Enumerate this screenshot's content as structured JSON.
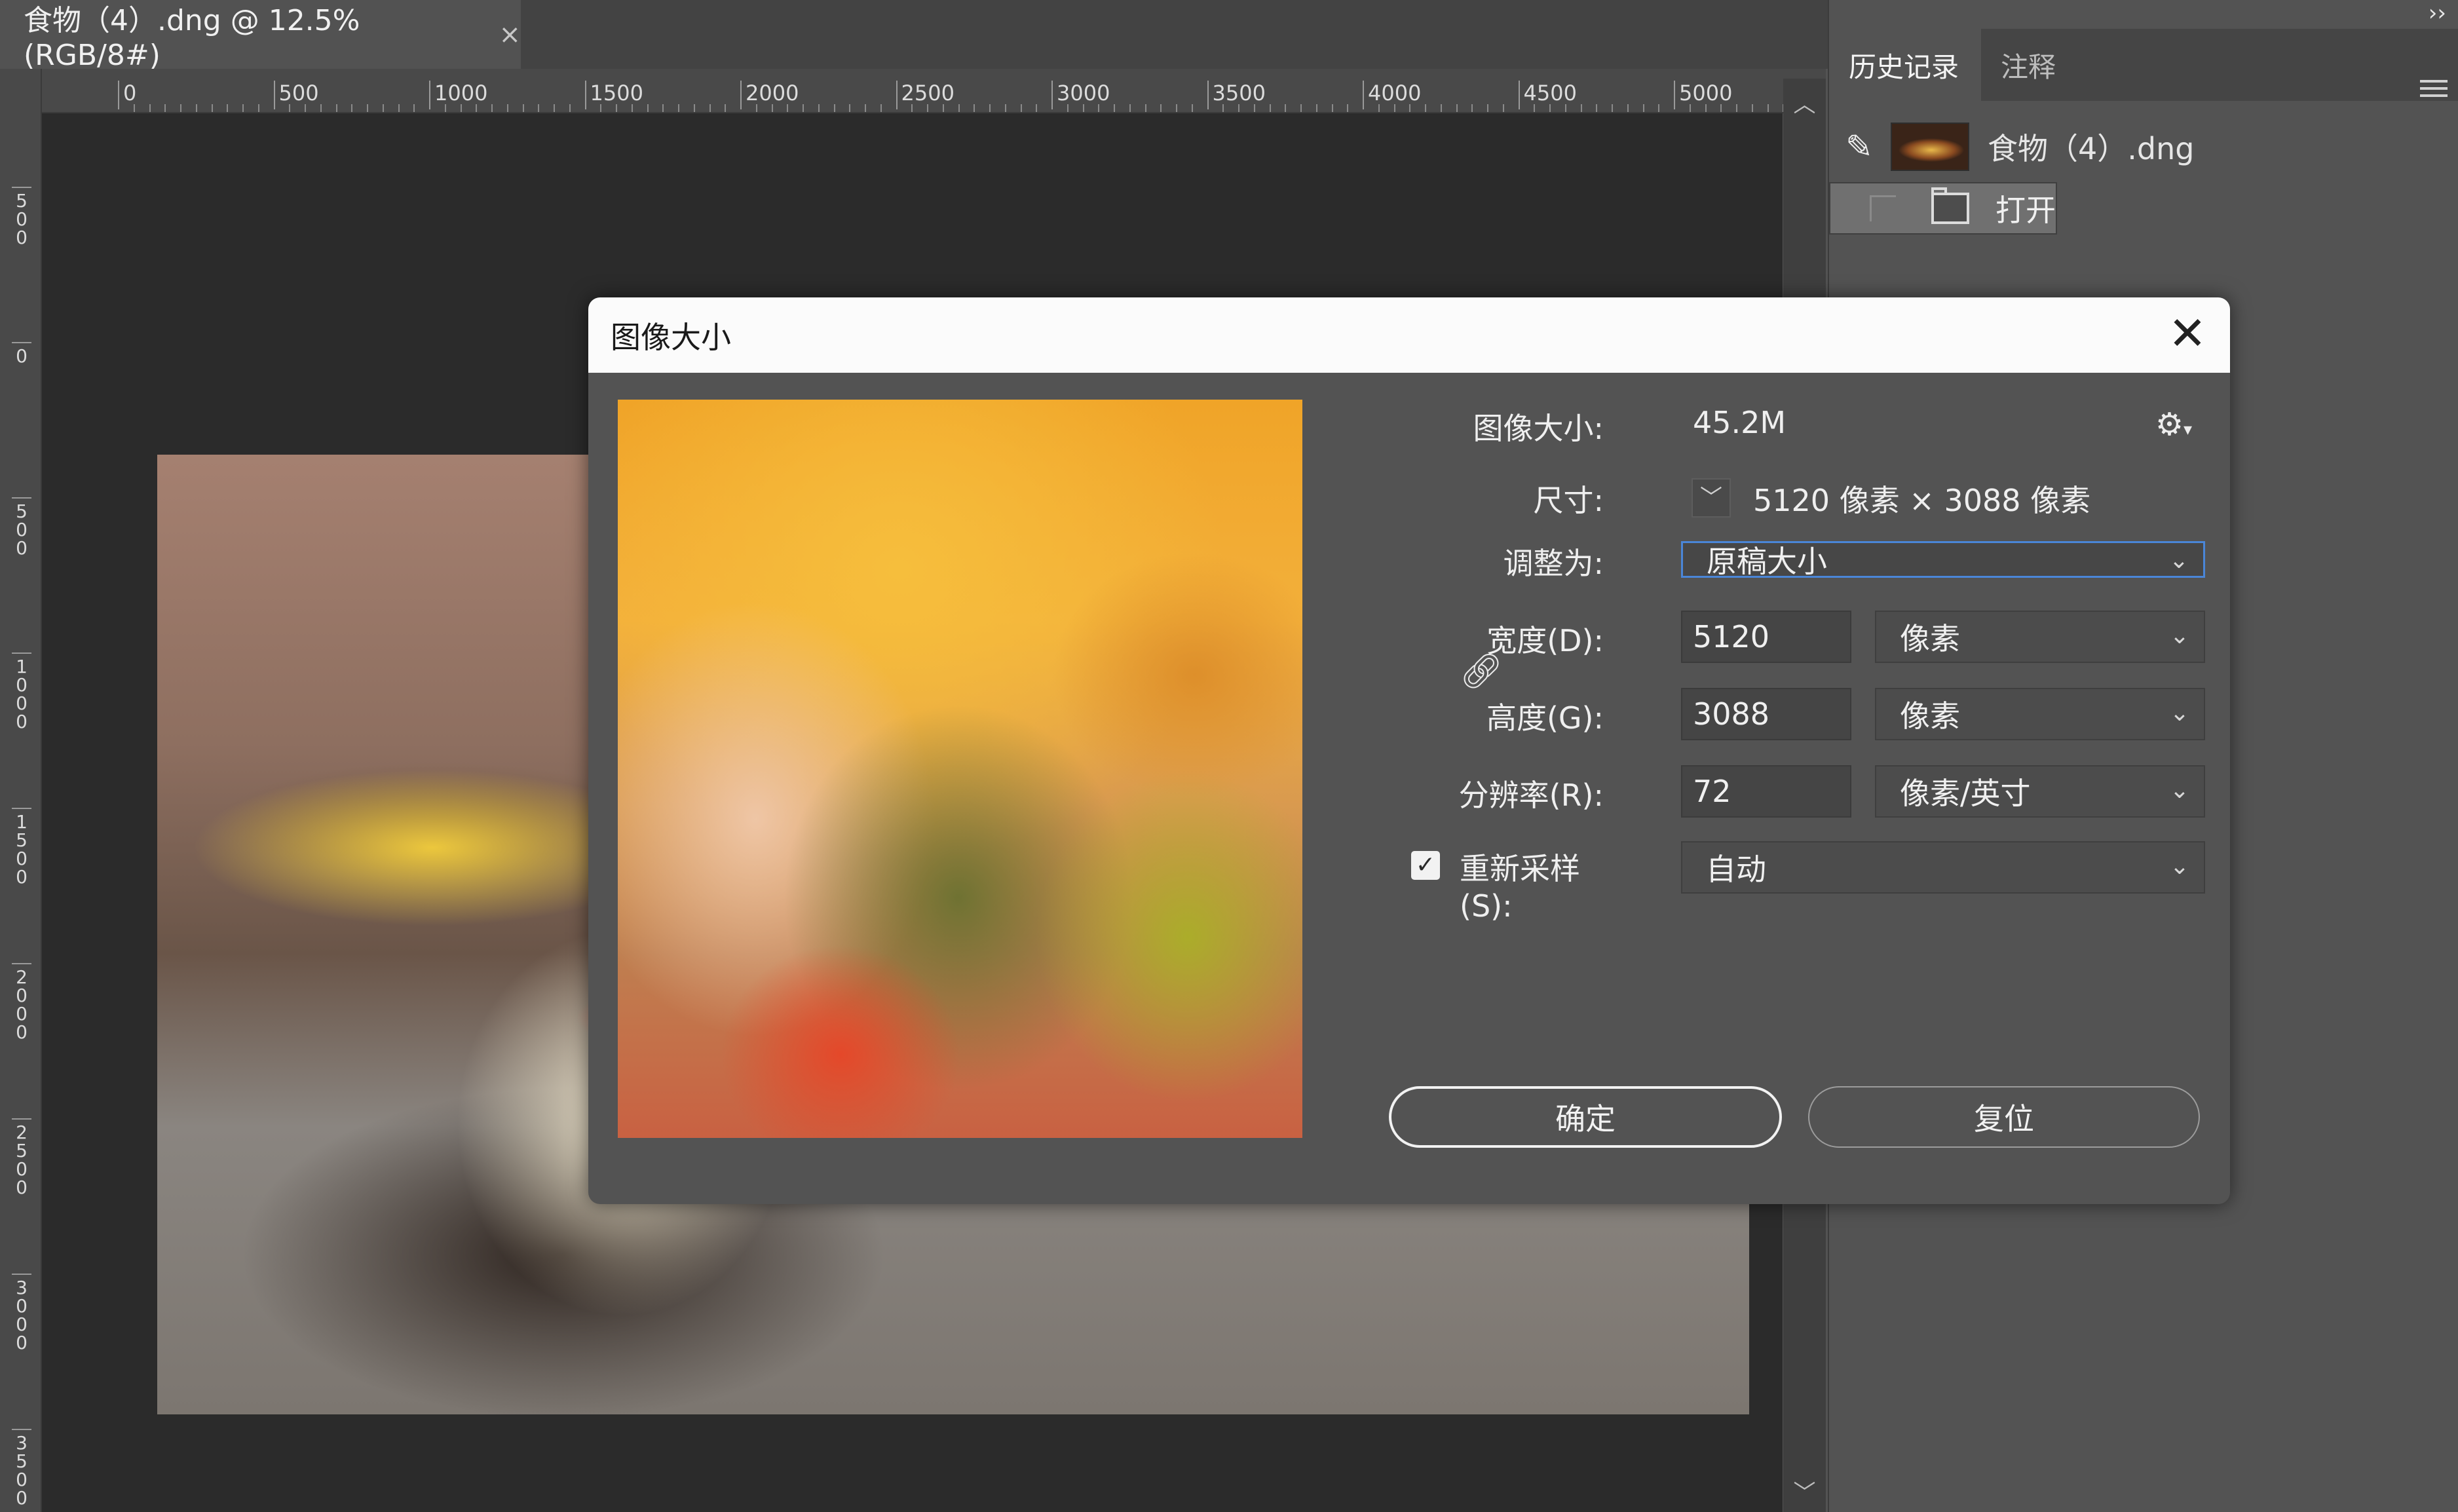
{
  "document_tab": {
    "title": "食物（4）.dng @ 12.5%(RGB/8#)",
    "close": "×"
  },
  "ruler_top": {
    "labels": [
      "0",
      "500",
      "1000",
      "1500",
      "2000",
      "2500",
      "3000",
      "3500",
      "4000",
      "4500",
      "5000"
    ]
  },
  "ruler_left": {
    "labels": [
      "500",
      "0",
      "500",
      "1000",
      "1500",
      "2000",
      "2500",
      "3000",
      "3500"
    ]
  },
  "scroll": {
    "up": "︿",
    "down": "﹀"
  },
  "panel": {
    "collapse": "››",
    "tabs": [
      "历史记录",
      "注释"
    ],
    "history": [
      {
        "label": "食物（4）.dng"
      },
      {
        "label": "打开"
      }
    ]
  },
  "dialog": {
    "title": "图像大小",
    "close": "✕",
    "image_size_label": "图像大小:",
    "image_size_value": "45.2M",
    "dimensions_label": "尺寸:",
    "dimensions_value": "5120 像素 × 3088 像素",
    "fit_to_label": "调整为:",
    "fit_to_value": "原稿大小",
    "width_label": "宽度(D):",
    "width_value": "5120",
    "width_unit": "像素",
    "height_label": "高度(G):",
    "height_value": "3088",
    "height_unit": "像素",
    "resolution_label": "分辨率(R):",
    "resolution_value": "72",
    "resolution_unit": "像素/英寸",
    "resample_label": "重新采样(S):",
    "resample_value": "自动",
    "resample_checked": true,
    "ok_button": "确定",
    "reset_button": "复位"
  }
}
